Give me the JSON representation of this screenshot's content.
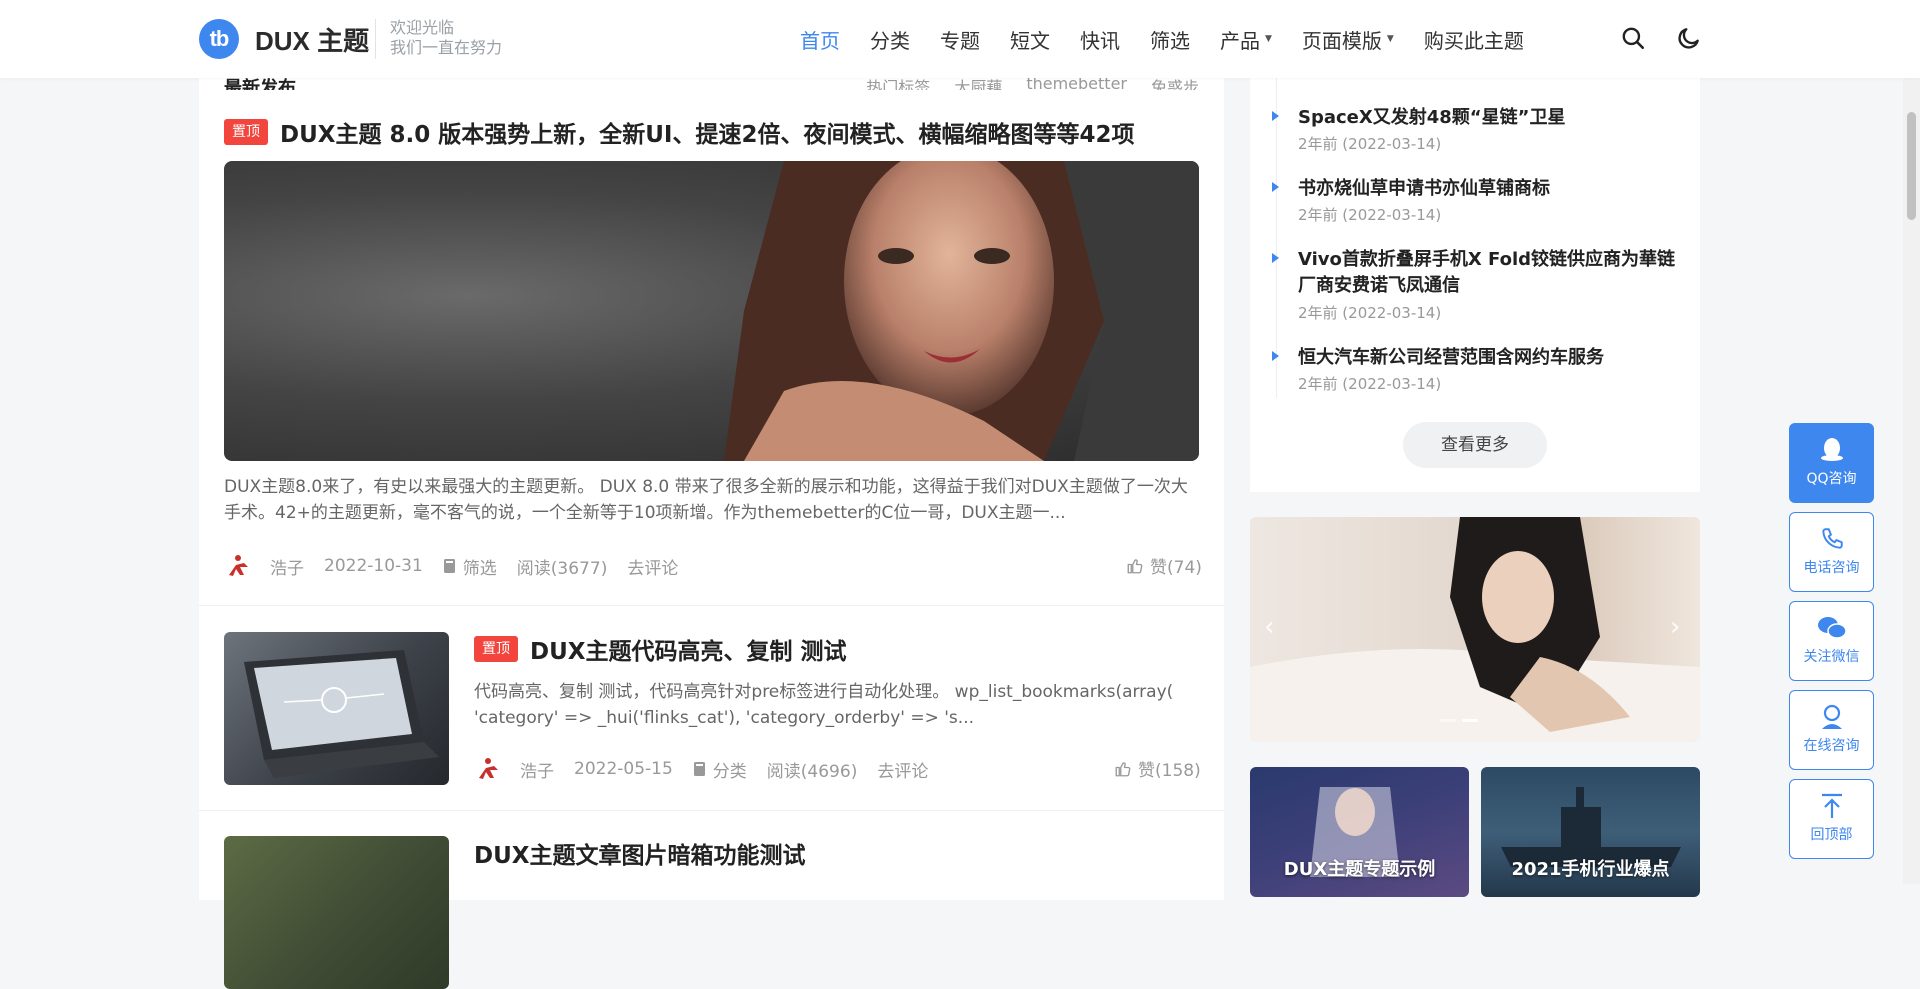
{
  "header": {
    "logo_mark": "tb",
    "logo_text": "DUX 主题",
    "slogan_line1": "欢迎光临",
    "slogan_line2": "我们一直在努力",
    "nav": [
      {
        "label": "首页",
        "active": true
      },
      {
        "label": "分类"
      },
      {
        "label": "专题"
      },
      {
        "label": "短文"
      },
      {
        "label": "快讯"
      },
      {
        "label": "筛选"
      },
      {
        "label": "产品",
        "dropdown": true
      },
      {
        "label": "页面模版",
        "dropdown": true
      },
      {
        "label": "购买此主题"
      }
    ],
    "search_icon": "search-icon",
    "theme_icon": "moon-icon"
  },
  "section": {
    "title": "最新发布",
    "tabs": [
      "热门标签",
      "大厨藕",
      "themebetter",
      "免惑步"
    ]
  },
  "posts": [
    {
      "badge": "置顶",
      "title": "DUX主题 8.0 版本强势上新，全新UI、提速2倍、夜间模式、横幅缩略图等等42项",
      "excerpt": "DUX主题8.0来了，有史以来最强大的主题更新。 DUX 8.0 带来了很多全新的展示和功能，这得益于我们对DUX主题做了一次大手术。42+的主题更新，毫不客气的说，一个全新等于10项新增。作为themebetter的C位一哥，DUX主题一...",
      "author": "浩子",
      "date": "2022-10-31",
      "category": "筛选",
      "views": "阅读(3677)",
      "comment": "去评论",
      "likes": "赞(74)"
    },
    {
      "badge": "置顶",
      "title": "DUX主题代码高亮、复制 测试",
      "excerpt": "代码高亮、复制 测试，代码高亮针对pre标签进行自动化处理。 wp_list_bookmarks(array( 'category' => _hui('flinks_cat'), 'category_orderby' => 's...",
      "author": "浩子",
      "date": "2022-05-15",
      "category": "分类",
      "views": "阅读(4696)",
      "comment": "去评论",
      "likes": "赞(158)"
    },
    {
      "title": "DUX主题文章图片暗箱功能测试"
    }
  ],
  "sidebar": {
    "items": [
      {
        "title": "SpaceX又发射48颗“星链”卫星",
        "date": "2年前 (2022-03-14)"
      },
      {
        "title": "书亦烧仙草申请书亦仙草铺商标",
        "date": "2年前 (2022-03-14)"
      },
      {
        "title": "Vivo首款折叠屏手机X Fold铰链供应商为華链厂商安费诺飞凤通信",
        "date": "2年前 (2022-03-14)"
      },
      {
        "title": "恒大汽车新公司经营范围含网约车服务",
        "date": "2年前 (2022-03-14)"
      }
    ],
    "more_label": "查看更多",
    "tiles": [
      "DUX主题专题示例",
      "2021手机行业爆点"
    ]
  },
  "float_bar": [
    {
      "label": "QQ咨询",
      "icon": "qq-icon"
    },
    {
      "label": "电话咨询",
      "icon": "phone-icon"
    },
    {
      "label": "关注微信",
      "icon": "wechat-icon"
    },
    {
      "label": "在线咨询",
      "icon": "support-icon"
    },
    {
      "label": "回顶部",
      "icon": "back-to-top-icon"
    }
  ],
  "colors": {
    "accent": "#3d87ee",
    "badge": "#f1453d"
  }
}
